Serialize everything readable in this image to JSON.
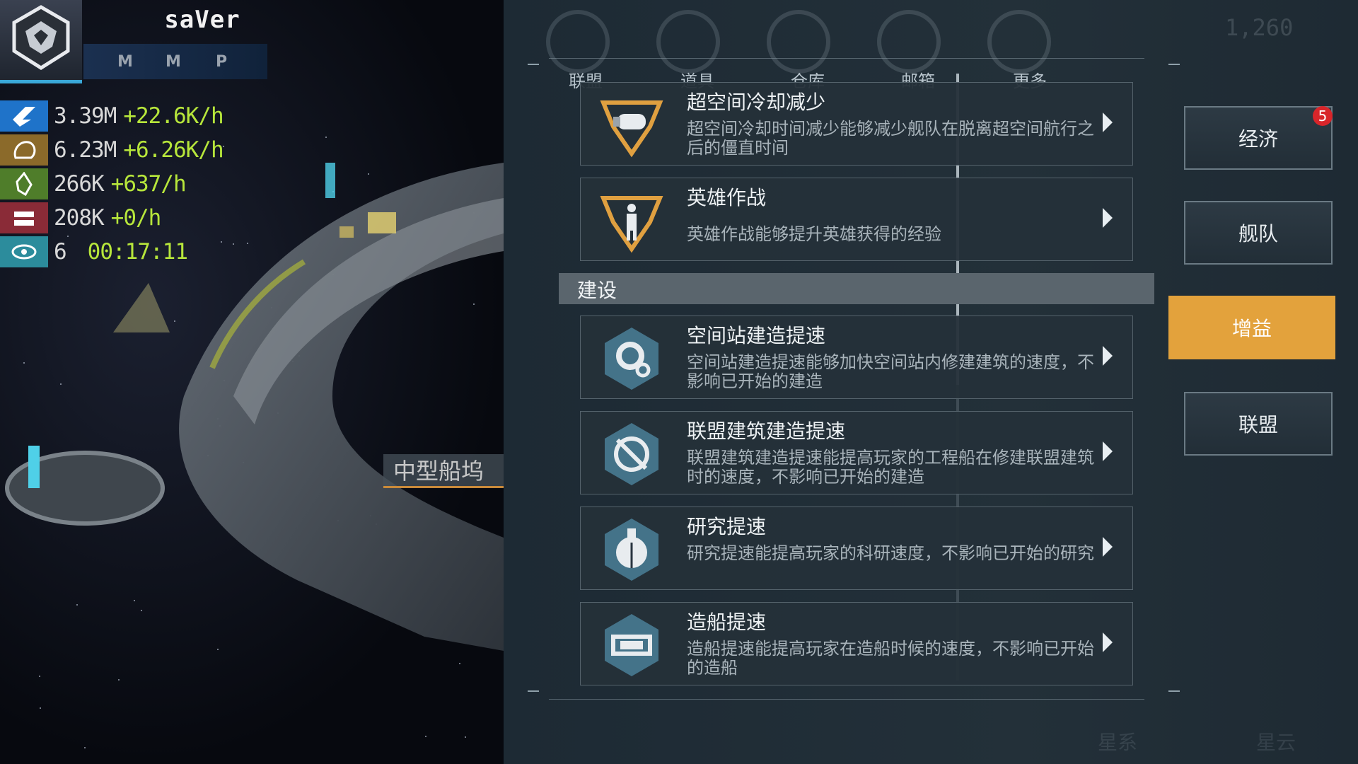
{
  "player": {
    "name": "saVer",
    "badges": [
      "M",
      "M",
      "P"
    ]
  },
  "resources": [
    {
      "icon": "energy-crystal-icon",
      "color": "#1f73c9",
      "amount": "3.39M",
      "rate": "+22.6K/h"
    },
    {
      "icon": "ore-icon",
      "color": "#8b6a2a",
      "amount": "6.23M",
      "rate": "+6.26K/h"
    },
    {
      "icon": "crystal-icon",
      "color": "#4f7d2a",
      "amount": "266K",
      "rate": "+637/h"
    },
    {
      "icon": "credits-icon",
      "color": "#8a2b37",
      "amount": "208K",
      "rate": "+0/h"
    },
    {
      "icon": "eye-icon",
      "color": "#2c8c9c",
      "amount": "6",
      "timer": "00:17:11"
    }
  ],
  "scene": {
    "dock_label": "中型船坞"
  },
  "top_nav": {
    "items": [
      "联盟",
      "道具",
      "仓库",
      "邮箱",
      "更多"
    ],
    "power": "1,260"
  },
  "boosts": [
    {
      "title": "超空间冷却减少",
      "desc": "超空间冷却时间减少能够减少舰队在脱离超空间航行之后的僵直时间",
      "icon": "hyperspace-engine-icon"
    },
    {
      "title": "英雄作战",
      "desc": "英雄作战能够提升英雄获得的经验",
      "icon": "hero-soldier-icon"
    }
  ],
  "section": {
    "title": "建设"
  },
  "build_boosts": [
    {
      "title": "空间站建造提速",
      "desc": "空间站建造提速能够加快空间站内修建建筑的速度，不影响已开始的建造",
      "icon": "station-gear-icon"
    },
    {
      "title": "联盟建筑建造提速",
      "desc": "联盟建筑建造提速能提高玩家的工程船在修建联盟建筑时的速度，不影响已开始的建造",
      "icon": "alliance-building-icon"
    },
    {
      "title": "研究提速",
      "desc": "研究提速能提高玩家的科研速度，不影响已开始的研究",
      "icon": "research-flask-icon"
    },
    {
      "title": "造船提速",
      "desc": "造船提速能提高玩家在造船时候的速度，不影响已开始的造船",
      "icon": "shipyard-icon"
    }
  ],
  "tabs": [
    {
      "label": "经济",
      "badge": "5"
    },
    {
      "label": "舰队"
    },
    {
      "label": "增益",
      "active": true
    },
    {
      "label": "联盟"
    }
  ],
  "bottom_nav": [
    "星系",
    "星云"
  ]
}
